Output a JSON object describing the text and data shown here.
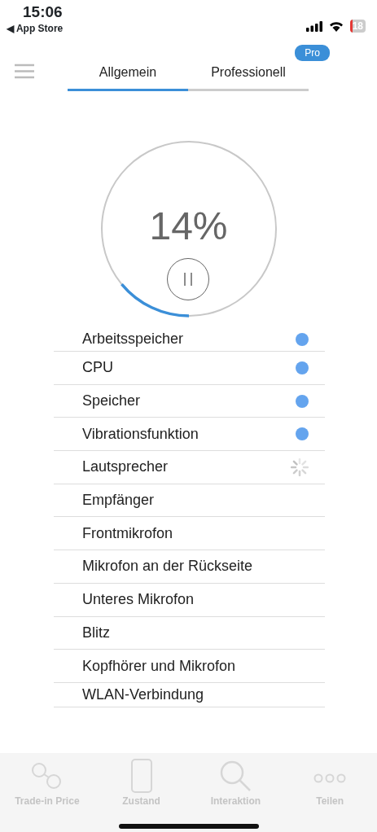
{
  "status_bar": {
    "time": "15:06",
    "back_label": "◀ App Store",
    "battery": "18"
  },
  "tabs": [
    {
      "label": "Allgemein",
      "selected": true
    },
    {
      "label": "Professionell",
      "selected": false,
      "badge": "Pro"
    }
  ],
  "progress": {
    "reading": "14%",
    "level": 0.14,
    "paused": false
  },
  "tests": [
    {
      "label": "Arbeitsspeicher",
      "kind": "done"
    },
    {
      "label": "CPU",
      "kind": "done"
    },
    {
      "label": "Speicher",
      "kind": "done"
    },
    {
      "label": "Vibrationsfunktion",
      "kind": "done"
    },
    {
      "label": "Lautsprecher",
      "kind": "testing"
    },
    {
      "label": "Empfänger",
      "kind": "pending"
    },
    {
      "label": "Frontmikrofon",
      "kind": "pending"
    },
    {
      "label": "Mikrofon an der Rückseite",
      "kind": "pending"
    },
    {
      "label": "Unteres Mikrofon",
      "kind": "pending"
    },
    {
      "label": "Blitz",
      "kind": "pending"
    },
    {
      "label": "Kopfhörer und Mikrofon",
      "kind": "pending"
    },
    {
      "label": "WLAN-Verbindung",
      "kind": "pending"
    }
  ],
  "bottom_tabs": [
    {
      "label": "Trade-in Price"
    },
    {
      "label": "Zustand"
    },
    {
      "label": "Interaktion"
    },
    {
      "label": "Teilen"
    }
  ]
}
